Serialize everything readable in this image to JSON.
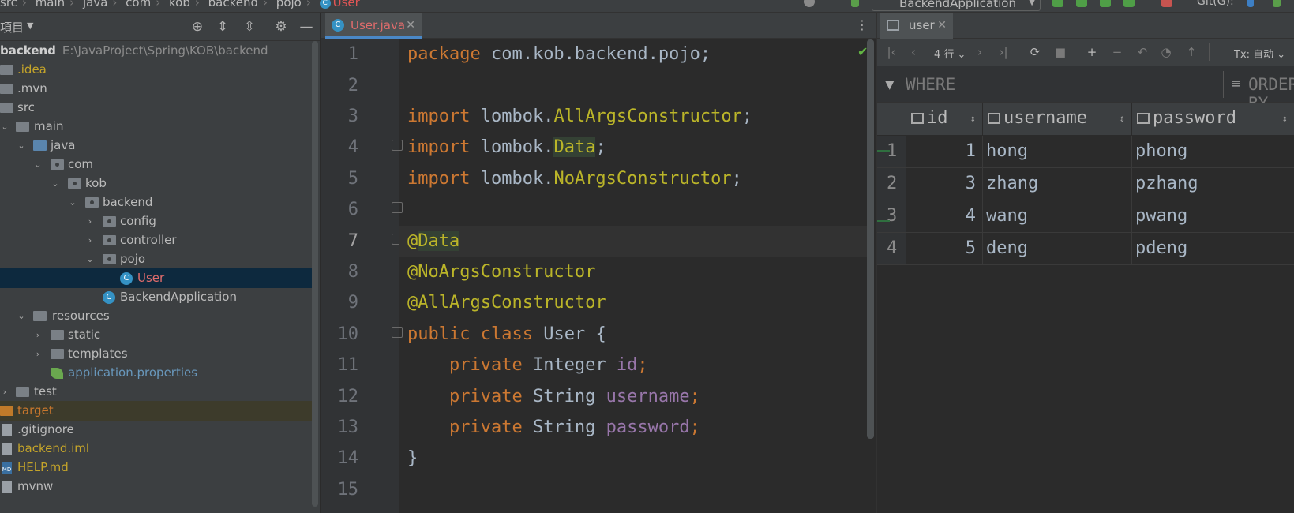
{
  "breadcrumb": [
    "src",
    "main",
    "java",
    "com",
    "kob",
    "backend",
    "pojo",
    "User"
  ],
  "run_config": {
    "label": "BackendApplication"
  },
  "git": {
    "label": "Git(G):"
  },
  "project_panel": {
    "title": "項目",
    "root": {
      "name": "backend",
      "path": "E:\\JavaProject\\Spring\\KOB\\backend"
    },
    "items": [
      {
        "label": ".idea"
      },
      {
        "label": ".mvn"
      },
      {
        "label": "src"
      },
      {
        "label": "main"
      },
      {
        "label": "java"
      },
      {
        "label": "com"
      },
      {
        "label": "kob"
      },
      {
        "label": "backend"
      },
      {
        "label": "config"
      },
      {
        "label": "controller"
      },
      {
        "label": "pojo"
      },
      {
        "label": "User"
      },
      {
        "label": "BackendApplication"
      },
      {
        "label": "resources"
      },
      {
        "label": "static"
      },
      {
        "label": "templates"
      },
      {
        "label": "application.properties"
      },
      {
        "label": "test"
      },
      {
        "label": "target"
      },
      {
        "label": ".gitignore"
      },
      {
        "label": "backend.iml"
      },
      {
        "label": "HELP.md"
      },
      {
        "label": "mvnw"
      }
    ]
  },
  "editor": {
    "tab": {
      "label": "User.java"
    },
    "line_numbers": [
      "1",
      "2",
      "3",
      "4",
      "5",
      "6",
      "7",
      "8",
      "9",
      "10",
      "11",
      "12",
      "13",
      "14",
      "15"
    ],
    "current_line": "7",
    "code": {
      "l1": {
        "kw": "package",
        "rest": " com.kob.backend.pojo;"
      },
      "l3": {
        "kw": "import",
        "pre": " lombok.",
        "cls": "AllArgsConstructor",
        "end": ";"
      },
      "l4": {
        "kw": "import",
        "pre": " lombok.",
        "cls": "Data",
        "end": ";"
      },
      "l5": {
        "kw": "import",
        "pre": " lombok.",
        "cls": "NoArgsConstructor",
        "end": ";"
      },
      "l7": {
        "at": "@",
        "ann": "Data"
      },
      "l8": {
        "ann": "@NoArgsConstructor"
      },
      "l9": {
        "ann": "@AllArgsConstructor"
      },
      "l10": {
        "kw1": "public",
        "kw2": " class",
        "rest": " User {"
      },
      "l11": {
        "indent": "    ",
        "kw": "private",
        "type": " Integer ",
        "field": "id",
        "end": ";"
      },
      "l12": {
        "indent": "    ",
        "kw": "private",
        "type": " String ",
        "field": "username",
        "end": ";"
      },
      "l13": {
        "indent": "    ",
        "kw": "private",
        "type": " String ",
        "field": "password",
        "end": ";"
      },
      "l14": {
        "rest": "}"
      }
    }
  },
  "db_panel": {
    "tab": {
      "label": "user"
    },
    "rows_selector": "4 行",
    "tx_selector": "Tx: 自动",
    "filter": {
      "where": "WHERE",
      "order": "ORDER BY"
    },
    "columns": [
      "id",
      "username",
      "password"
    ],
    "rows": [
      {
        "n": "1",
        "id": "1",
        "username": "hong",
        "password": "phong"
      },
      {
        "n": "2",
        "id": "3",
        "username": "zhang",
        "password": "pzhang"
      },
      {
        "n": "3",
        "id": "4",
        "username": "wang",
        "password": "pwang"
      },
      {
        "n": "4",
        "id": "5",
        "username": "deng",
        "password": "pdeng"
      }
    ]
  },
  "colors": {
    "keyword": "#cc7832",
    "annotation": "#bbb529",
    "field": "#9876aa",
    "selection": "#0d293e",
    "accent": "#4a88c7"
  }
}
